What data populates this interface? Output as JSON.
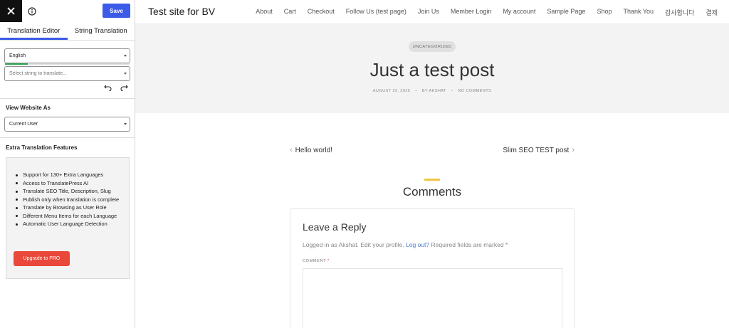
{
  "sidebar": {
    "save_label": "Save",
    "tabs": [
      {
        "label": "Translation Editor",
        "active": true
      },
      {
        "label": "String Translation",
        "active": false
      }
    ],
    "language_select": {
      "value": "English"
    },
    "translation_progress": 0.18,
    "string_select": {
      "placeholder": "Select string to translate..."
    },
    "view_as": {
      "label": "View Website As",
      "value": "Current User"
    },
    "extra": {
      "title": "Extra Translation Features",
      "features": [
        "Support for 130+ Extra Languages",
        "Access to TranslatePress AI",
        "Translate SEO Title, Description, Slug",
        "Publish only when translation is complete",
        "Translate by Browsing as User Role",
        "Different Menu Items for each Language",
        "Automatic User Language Detection"
      ],
      "pro_button": "Upgrade to PRO"
    },
    "accent_color": "#3b5be8",
    "pro_color": "#e9483a"
  },
  "site": {
    "title": "Test site for BV",
    "nav": [
      "About",
      "Cart",
      "Checkout",
      "Follow Us (test page)",
      "Join Us",
      "Member Login",
      "My account",
      "Sample Page",
      "Shop",
      "Thank You",
      "감사합니다",
      "결제"
    ],
    "post": {
      "category": "UNCATEGORIZED",
      "title": "Just a test post",
      "date": "AUGUST 22, 2025",
      "author": "BY AKSHAT",
      "comments": "NO COMMENTS"
    },
    "prev_post": "Hello world!",
    "next_post": "Slim SEO TEST post",
    "comments_heading": "Comments",
    "reply": {
      "title": "Leave a Reply",
      "logged_in_prefix": "Logged in as Akshat. Edit your profile. ",
      "logout_link": "Log out?",
      "logged_in_suffix": " Required fields are marked *",
      "comment_label": "COMMENT",
      "required_mark": "*"
    },
    "comments_accent_color": "#f0c443"
  }
}
